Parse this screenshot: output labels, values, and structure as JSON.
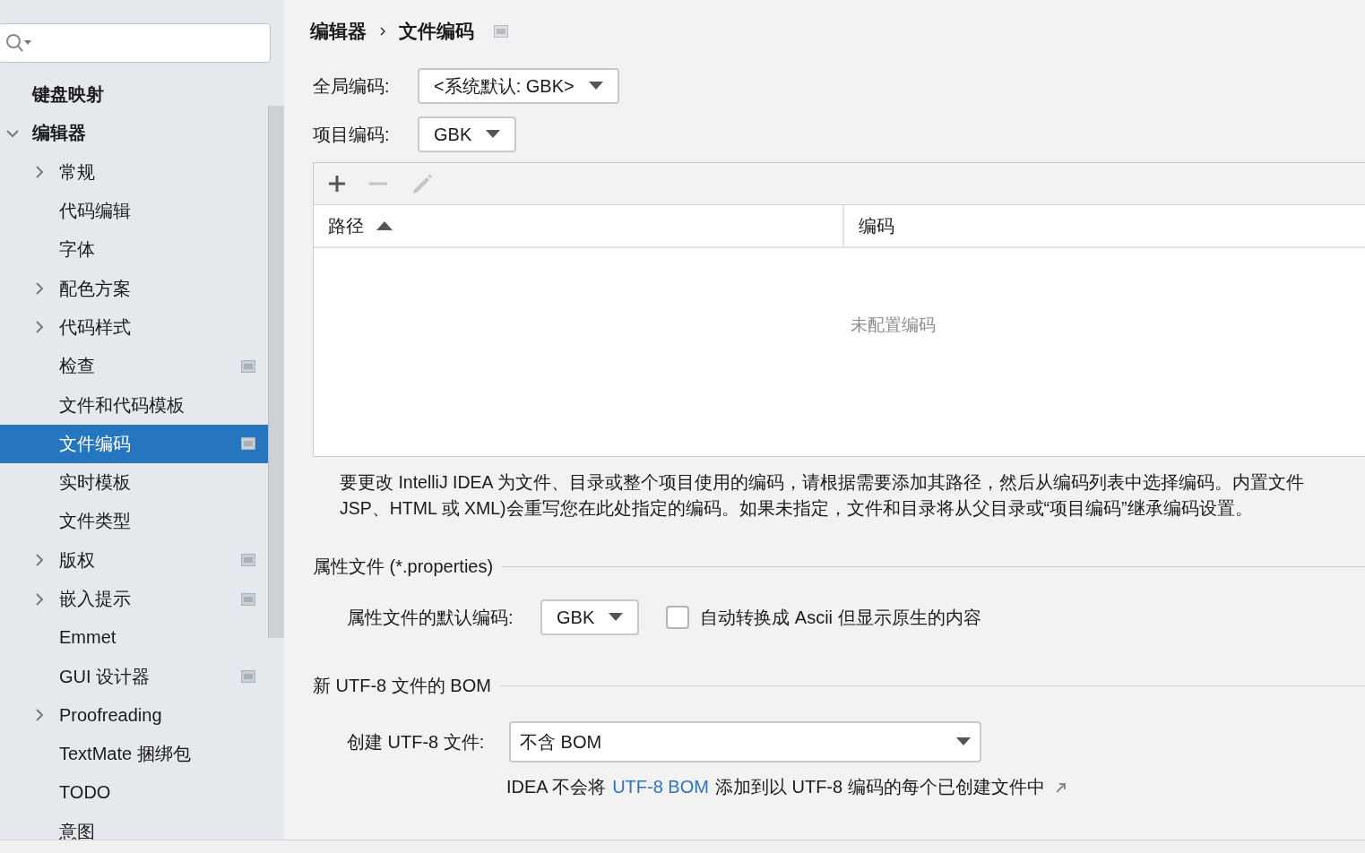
{
  "sidebar": {
    "items": [
      {
        "label": "键盘映射",
        "selected": false,
        "project_icon": false
      },
      {
        "label": "编辑器",
        "expanded": true,
        "selected": false,
        "project_icon": false,
        "children": [
          {
            "label": "常规",
            "expanded": false,
            "selected": false,
            "project_icon": false
          },
          {
            "label": "代码编辑",
            "selected": false,
            "project_icon": false
          },
          {
            "label": "字体",
            "selected": false,
            "project_icon": false
          },
          {
            "label": "配色方案",
            "expanded": false,
            "selected": false,
            "project_icon": false
          },
          {
            "label": "代码样式",
            "expanded": false,
            "selected": false,
            "project_icon": false
          },
          {
            "label": "检查",
            "selected": false,
            "project_icon": true
          },
          {
            "label": "文件和代码模板",
            "selected": false,
            "project_icon": false
          },
          {
            "label": "文件编码",
            "selected": true,
            "project_icon": true
          },
          {
            "label": "实时模板",
            "selected": false,
            "project_icon": false
          },
          {
            "label": "文件类型",
            "selected": false,
            "project_icon": false
          },
          {
            "label": "版权",
            "expanded": false,
            "selected": false,
            "project_icon": true
          },
          {
            "label": "嵌入提示",
            "expanded": false,
            "selected": false,
            "project_icon": true
          },
          {
            "label": "Emmet",
            "selected": false,
            "project_icon": false
          },
          {
            "label": "GUI 设计器",
            "selected": false,
            "project_icon": true
          },
          {
            "label": "Proofreading",
            "expanded": false,
            "selected": false,
            "project_icon": false
          },
          {
            "label": "TextMate 捆绑包",
            "selected": false,
            "project_icon": false
          },
          {
            "label": "TODO",
            "selected": false,
            "project_icon": false
          },
          {
            "label": "意图",
            "selected": false,
            "project_icon": false
          }
        ]
      }
    ]
  },
  "breadcrumb": {
    "items": [
      "编辑器",
      "文件编码"
    ],
    "project_icon": true
  },
  "global_encoding": {
    "label": "全局编码:",
    "value": "<系统默认: GBK>"
  },
  "project_encoding": {
    "label": "项目编码:",
    "value": "GBK"
  },
  "table": {
    "columns": [
      {
        "label": "路径",
        "sorted_ascending": true
      },
      {
        "label": "编码",
        "sorted_ascending": false
      }
    ],
    "empty_text": "未配置编码"
  },
  "description": [
    "要更改 IntelliJ IDEA 为文件、目录或整个项目使用的编码，请根据需要添加其路径，然后从编码列表中选择编码。内置文件",
    "JSP、HTML 或 XML)会重写您在此处指定的编码。如果未指定，文件和目录将从父目录或“项目编码”继承编码设置。"
  ],
  "properties": {
    "title": "属性文件 (*.properties)",
    "label": "属性文件的默认编码:",
    "value": "GBK",
    "checkbox": {
      "label": "自动转换成 Ascii 但显示原生的内容",
      "checked": false
    }
  },
  "bom": {
    "title": "新 UTF-8 文件的 BOM",
    "label": "创建 UTF-8 文件:",
    "value": "不含 BOM",
    "note_before": "IDEA 不会将",
    "note_link": "UTF-8 BOM",
    "note_after": "添加到以 UTF-8 编码的每个已创建文件中"
  }
}
